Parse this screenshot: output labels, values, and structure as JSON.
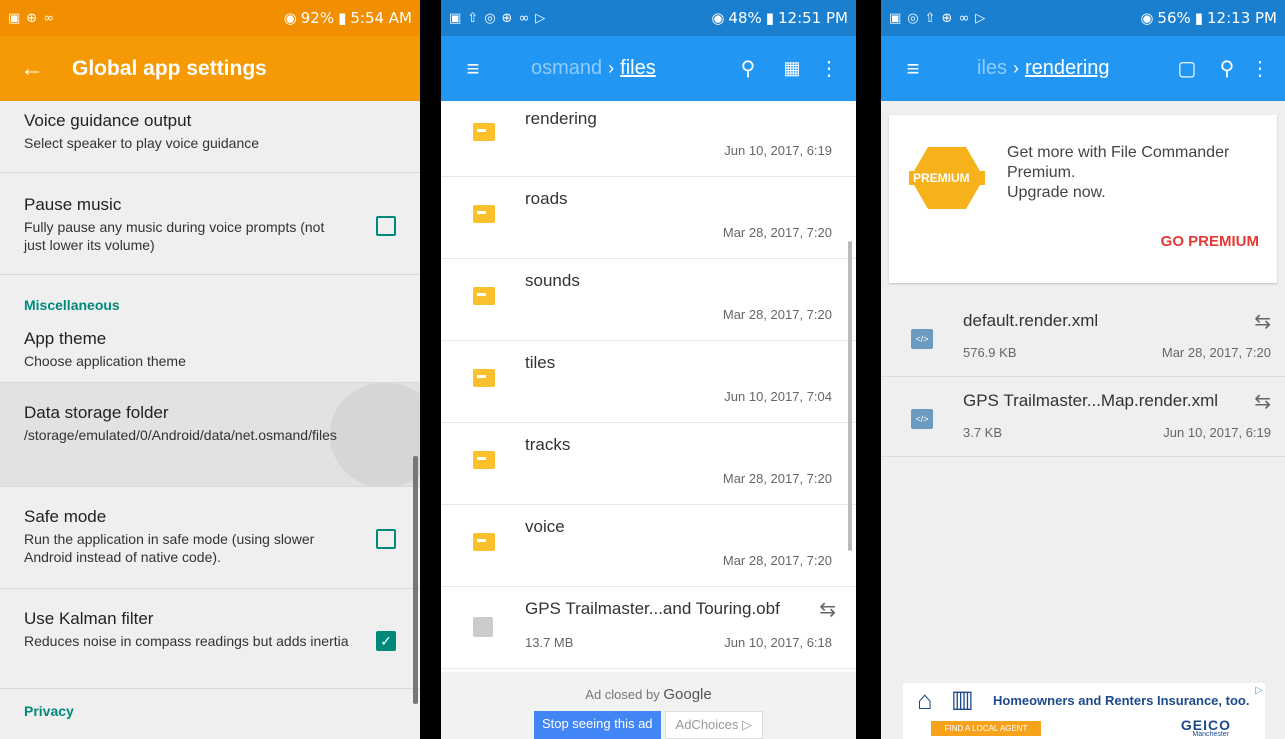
{
  "screen1": {
    "status": {
      "battery": "92%",
      "time": "5:54 AM"
    },
    "title": "Global app settings",
    "prefs": [
      {
        "title": "Voice guidance output",
        "summary": "Select speaker to play voice guidance"
      },
      {
        "title": "Pause music",
        "summary": "Fully pause any music during voice prompts (not just lower its volume)",
        "checked": false
      }
    ],
    "section_misc": "Miscellaneous",
    "prefs2": [
      {
        "title": "App theme",
        "summary": "Choose application theme"
      },
      {
        "title": "Data storage folder",
        "summary": "/storage/emulated/0/Android/data/net.osmand/files"
      },
      {
        "title": "Safe mode",
        "summary": "Run the application in safe mode (using slower Android instead of native code).",
        "checked": false
      },
      {
        "title": "Use Kalman filter",
        "summary": "Reduces noise in compass readings but adds inertia",
        "checked": true
      }
    ],
    "section_privacy": "Privacy"
  },
  "screen2": {
    "status": {
      "battery": "48%",
      "time": "12:51 PM"
    },
    "crumb_prev": "osmand",
    "crumb_current": "files",
    "folders": [
      {
        "name": "rendering",
        "date": "Jun 10, 2017, 6:19"
      },
      {
        "name": "roads",
        "date": "Mar 28, 2017, 7:20"
      },
      {
        "name": "sounds",
        "date": "Mar 28, 2017, 7:20"
      },
      {
        "name": "tiles",
        "date": "Jun 10, 2017, 7:04"
      },
      {
        "name": "tracks",
        "date": "Mar 28, 2017, 7:20"
      },
      {
        "name": "voice",
        "date": "Mar 28, 2017, 7:20"
      }
    ],
    "file": {
      "name": "GPS Trailmaster...and Touring.obf",
      "size": "13.7 MB",
      "date": "Jun 10, 2017, 6:18"
    },
    "ad_closed": "Ad closed by",
    "ad_google": "Google",
    "ad_stop": "Stop seeing this ad",
    "ad_choices": "AdChoices"
  },
  "screen3": {
    "status": {
      "battery": "56%",
      "time": "12:13 PM"
    },
    "crumb_prev": "iles",
    "crumb_current": "rendering",
    "premium_badge": "PREMIUM",
    "premium_text_1": "Get more with File Commander Premium.",
    "premium_text_2": "Upgrade now.",
    "go_premium": "GO PREMIUM",
    "files": [
      {
        "name": "default.render.xml",
        "size": "576.9 KB",
        "date": "Mar 28, 2017, 7:20"
      },
      {
        "name": "GPS Trailmaster...Map.render.xml",
        "size": "3.7 KB",
        "date": "Jun 10, 2017, 6:19"
      }
    ],
    "ad_text": "Homeowners and Renters Insurance, too.",
    "ad_cta": "FIND A LOCAL AGENT",
    "ad_brand": "GEICO",
    "ad_sub": "Manchester"
  }
}
